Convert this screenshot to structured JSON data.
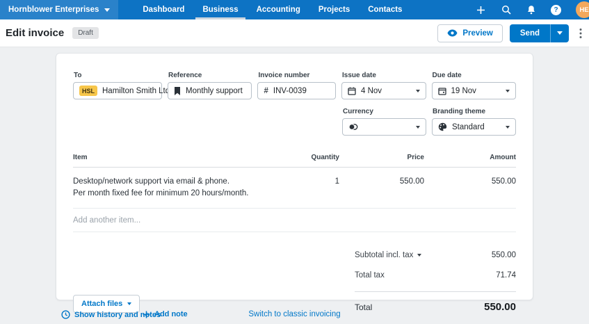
{
  "topbar": {
    "org": "Hornblower Enterprises",
    "nav": [
      {
        "label": "Dashboard",
        "active": false
      },
      {
        "label": "Business",
        "active": true
      },
      {
        "label": "Accounting",
        "active": false
      },
      {
        "label": "Projects",
        "active": false
      },
      {
        "label": "Contacts",
        "active": false
      }
    ],
    "help_glyph": "?",
    "avatar": "HE"
  },
  "header": {
    "title": "Edit invoice",
    "status": "Draft",
    "preview_label": "Preview",
    "send_label": "Send"
  },
  "form": {
    "to": {
      "label": "To",
      "chip": "HSL",
      "value": "Hamilton Smith Ltd",
      "close_glyph": "×"
    },
    "reference": {
      "label": "Reference",
      "value": "Monthly support"
    },
    "invoice_number": {
      "label": "Invoice number",
      "prefix": "#",
      "value": "INV-0039"
    },
    "issue_date": {
      "label": "Issue date",
      "value": "4 Nov"
    },
    "due_date": {
      "label": "Due date",
      "value": "19 Nov"
    },
    "currency": {
      "label": "Currency",
      "value": ""
    },
    "branding_theme": {
      "label": "Branding theme",
      "value": "Standard"
    }
  },
  "items": {
    "columns": [
      "Item",
      "Quantity",
      "Price",
      "Amount"
    ],
    "rows": [
      {
        "description_line1": "Desktop/network support via email & phone.",
        "description_line2": "Per month fixed fee for minimum 20 hours/month.",
        "quantity": "1",
        "price": "550.00",
        "amount": "550.00"
      }
    ],
    "add_placeholder": "Add another item..."
  },
  "totals": {
    "subtotal_label": "Subtotal incl. tax",
    "subtotal": "550.00",
    "total_tax_label": "Total tax",
    "total_tax": "71.74",
    "total_label": "Total",
    "total": "550.00"
  },
  "footer": {
    "attach_label": "Attach files",
    "history_label": "Show history and notes",
    "add_note_label": "Add note",
    "switch_label": "Switch to classic invoicing"
  },
  "colors": {
    "navbar": "#0d73c4",
    "accent": "#0077c8",
    "avatar": "#f3a85c",
    "chip": "#f7c64a",
    "status_badge_bg": "#e3e4e6"
  }
}
